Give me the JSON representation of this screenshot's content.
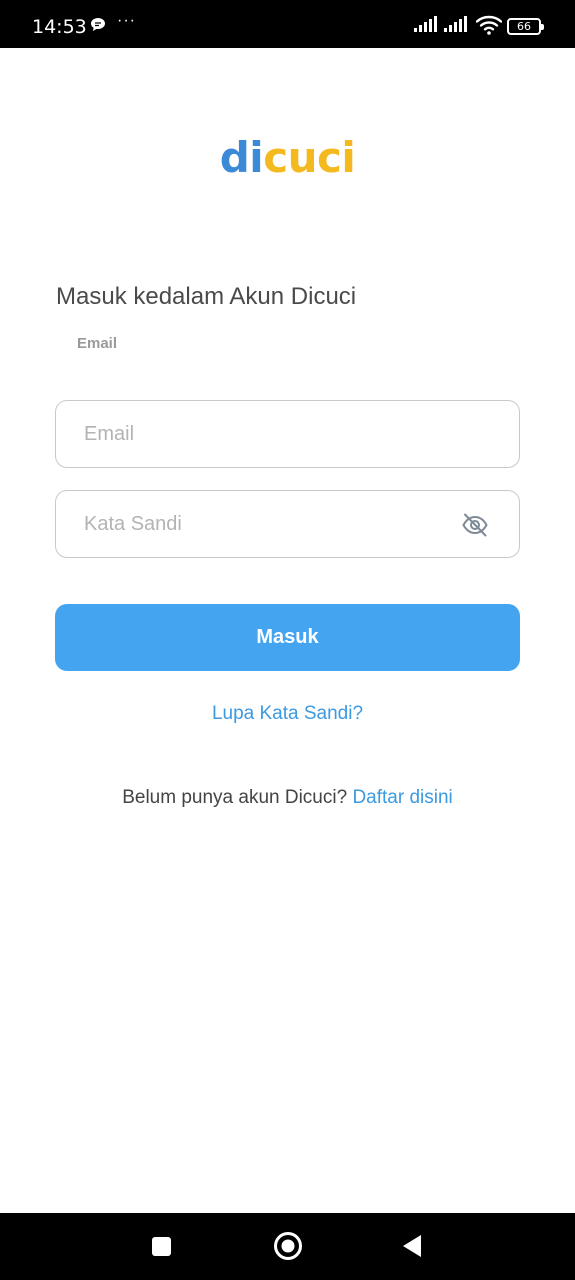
{
  "status_bar": {
    "time": "14:53",
    "dots": "···",
    "battery": "66"
  },
  "logo": {
    "part1": "di",
    "part2": "cuci",
    "colors": {
      "di": "#3a8ad8",
      "cuci": "#f5b920"
    }
  },
  "login": {
    "title": "Masuk kedalam Akun Dicuci",
    "email_label": "Email",
    "email_placeholder": "Email",
    "email_value": "",
    "password_placeholder": "Kata Sandi",
    "password_value": "",
    "submit_label": "Masuk",
    "forgot_label": "Lupa Kata Sandi?",
    "register_prompt": "Belum punya akun Dicuci?",
    "register_link": "Daftar disini"
  },
  "icons": {
    "status": [
      "chat-bubble-icon",
      "signal-icon",
      "signal-icon",
      "wifi-icon",
      "battery-icon"
    ],
    "password_toggle": "eye-off-icon",
    "nav": [
      "recent-apps-icon",
      "home-icon",
      "back-icon"
    ]
  },
  "colors": {
    "primary": "#45a4f0",
    "link": "#3b9ae0",
    "text": "#4a4a4a",
    "border": "#c9c9c9"
  }
}
